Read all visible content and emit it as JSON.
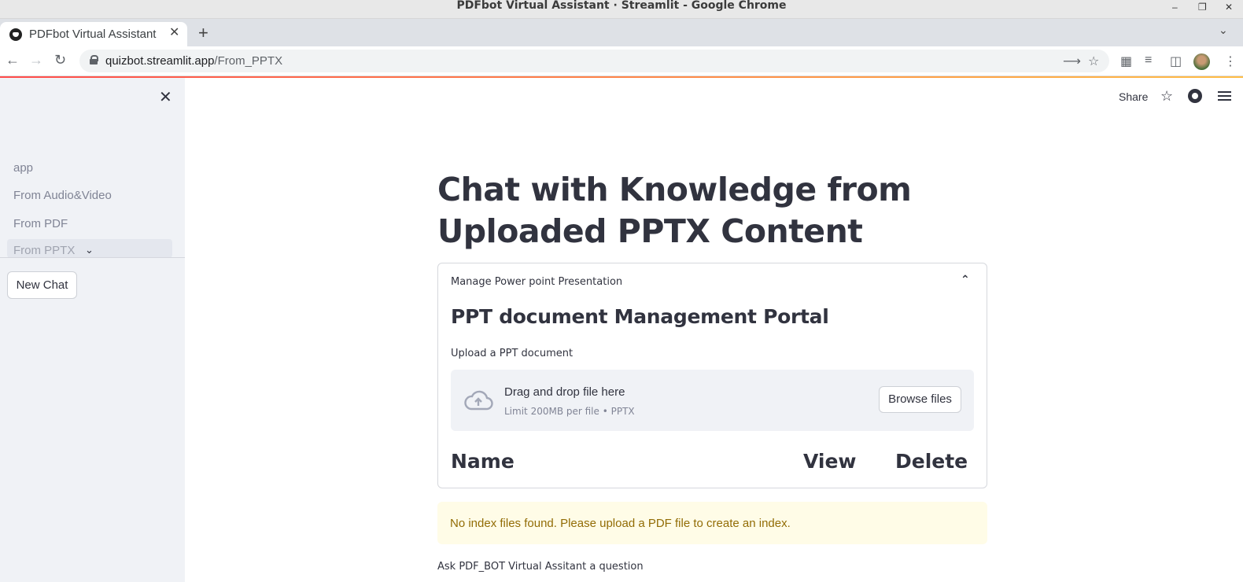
{
  "window": {
    "title": "PDFbot Virtual Assistant · Streamlit - Google Chrome"
  },
  "browser": {
    "tab_title": "PDFbot Virtual Assistant",
    "url_host": "quizbot.streamlit.app",
    "url_path": "/From_PPTX"
  },
  "sidebar": {
    "nav": [
      {
        "label": "app"
      },
      {
        "label": "From Audio&Video"
      },
      {
        "label": "From PDF"
      },
      {
        "label": "From PPTX"
      }
    ],
    "new_chat_label": "New Chat"
  },
  "header": {
    "share_label": "Share"
  },
  "main": {
    "title": "Chat with Knowledge from Uploaded PPTX Content",
    "expander": {
      "title": "Manage Power point Presentation",
      "heading": "PPT document Management Portal",
      "upload_label": "Upload a PPT document",
      "dropzone_text": "Drag and drop file here",
      "dropzone_limit": "Limit 200MB per file • PPTX",
      "browse_label": "Browse files",
      "columns": [
        "Name",
        "View",
        "Delete"
      ]
    },
    "warning": "No index files found. Please upload a PDF file to create an index.",
    "question_label": "Ask PDF_BOT Virtual Assitant a question"
  },
  "colors": {
    "accent": "#ff4b4b",
    "sidebar_bg": "#f0f2f6",
    "warning_bg": "#fffce7",
    "warning_text": "#926c05"
  }
}
